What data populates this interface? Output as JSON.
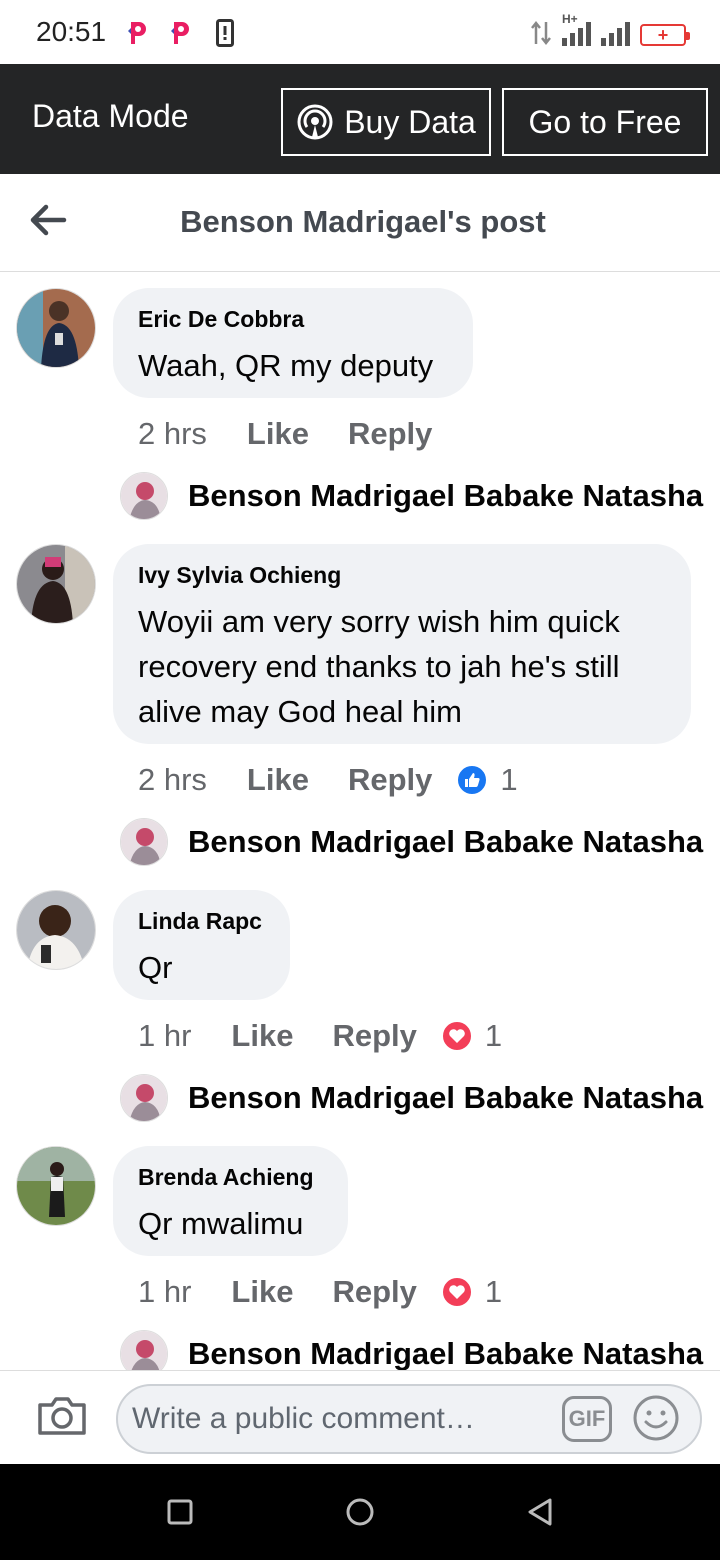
{
  "status_bar": {
    "time": "20:51",
    "network": "H+",
    "battery_icon": "battery-charging-icon"
  },
  "data_mode": {
    "title": "Data Mode",
    "buy_label": "Buy Data",
    "free_label": "Go to Free"
  },
  "header": {
    "title": "Benson Madrigael's post"
  },
  "comments": [
    {
      "author": "Eric De Cobbra",
      "text": "Waah, QR my deputy",
      "time": "2 hrs",
      "like": "Like",
      "reply": "Reply",
      "reply_author": "Benson Madrigael Babake Natasha"
    },
    {
      "author": "Ivy Sylvia Ochieng",
      "text": "Woyii am very sorry wish him quick recovery end thanks to jah he's still alive may God heal him",
      "time": "2 hrs",
      "like": "Like",
      "reply": "Reply",
      "reaction_type": "like",
      "reaction_count": "1",
      "reply_author": "Benson Madrigael Babake Natasha"
    },
    {
      "author": "Linda Rapc",
      "text": "Qr",
      "time": "1 hr",
      "like": "Like",
      "reply": "Reply",
      "reaction_type": "love",
      "reaction_count": "1",
      "reply_author": "Benson Madrigael Babake Natasha"
    },
    {
      "author": "Brenda Achieng",
      "text": "Qr mwalimu",
      "time": "1 hr",
      "like": "Like",
      "reply": "Reply",
      "reaction_type": "love",
      "reaction_count": "1",
      "reply_author": "Benson Madrigael Babake Natasha"
    }
  ],
  "composer": {
    "placeholder": "Write a public comment…",
    "gif_label": "GIF"
  },
  "colors": {
    "like_blue": "#1877f2",
    "love_red": "#f33e58",
    "dark_bar": "#242526",
    "bubble": "#f0f2f5"
  }
}
